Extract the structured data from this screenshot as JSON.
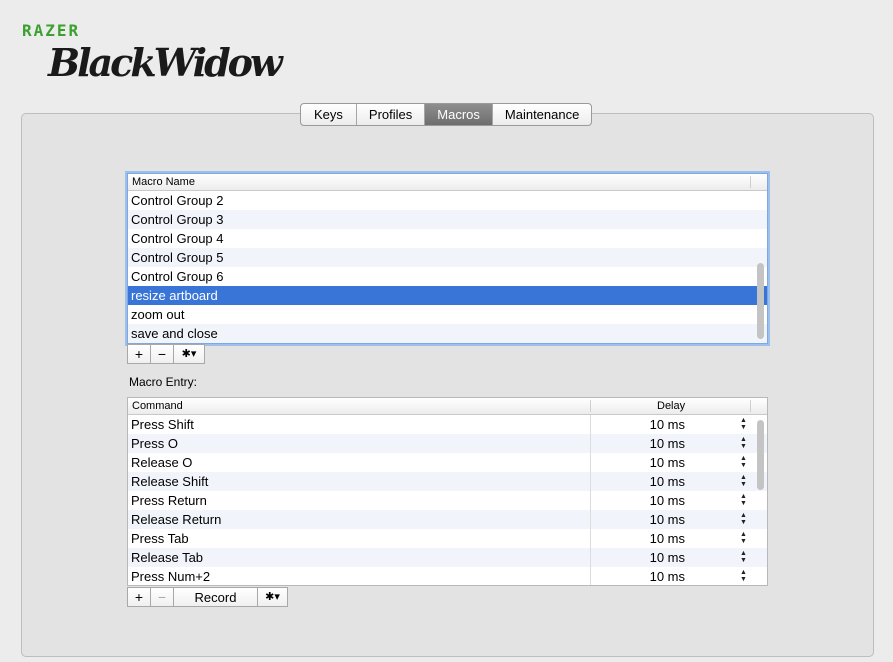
{
  "logo": {
    "brand": "RAZER",
    "product": "BlackWidow"
  },
  "tabs": [
    "Keys",
    "Profiles",
    "Macros",
    "Maintenance"
  ],
  "active_tab": "Macros",
  "macros": {
    "header": "Macro Name",
    "items": [
      "Control Group 2",
      "Control Group 3",
      "Control Group 4",
      "Control Group 5",
      "Control Group 6",
      "resize artboard",
      "zoom out",
      "save and close"
    ],
    "selected": "resize artboard"
  },
  "macro_buttons": {
    "add": "+",
    "remove": "−",
    "gear": "✱▾"
  },
  "entry_label": "Macro Entry:",
  "entries": {
    "headers": {
      "command": "Command",
      "delay": "Delay"
    },
    "rows": [
      {
        "command": "Press Shift",
        "delay": "10 ms"
      },
      {
        "command": "Press O",
        "delay": "10 ms"
      },
      {
        "command": "Release O",
        "delay": "10 ms"
      },
      {
        "command": "Release Shift",
        "delay": "10 ms"
      },
      {
        "command": "Press Return",
        "delay": "10 ms"
      },
      {
        "command": "Release Return",
        "delay": "10 ms"
      },
      {
        "command": "Press Tab",
        "delay": "10 ms"
      },
      {
        "command": "Release Tab",
        "delay": "10 ms"
      },
      {
        "command": "Press Num+2",
        "delay": "10 ms"
      }
    ]
  },
  "entry_buttons": {
    "add": "+",
    "remove": "−",
    "record": "Record",
    "gear": "✱▾"
  },
  "stepper_glyph": "▲▼"
}
